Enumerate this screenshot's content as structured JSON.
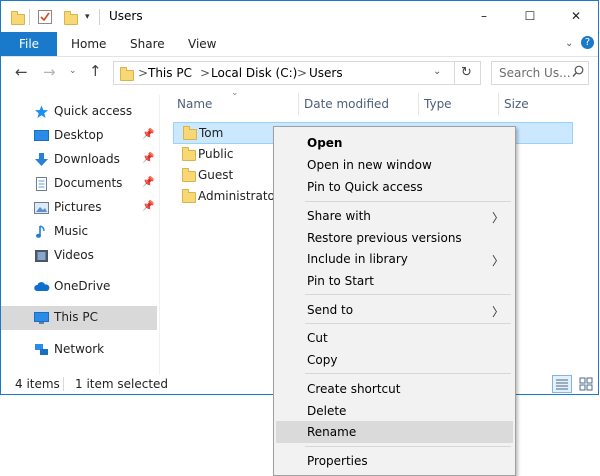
{
  "window": {
    "title": "Users",
    "controls": {
      "minimize": "–",
      "maximize": "☐",
      "close": "✕"
    }
  },
  "ribbon": {
    "file": "File",
    "tabs": [
      "Home",
      "Share",
      "View"
    ]
  },
  "address": {
    "crumbs": [
      "This PC",
      "Local Disk (C:)",
      "Users"
    ],
    "separator": ">",
    "search_placeholder": "Search Us..."
  },
  "sidebar": {
    "items": [
      {
        "label": "Quick access",
        "icon": "star-icon",
        "pinned": false
      },
      {
        "label": "Desktop",
        "icon": "desktop-icon",
        "pinned": true
      },
      {
        "label": "Downloads",
        "icon": "download-icon",
        "pinned": true
      },
      {
        "label": "Documents",
        "icon": "documents-icon",
        "pinned": true
      },
      {
        "label": "Pictures",
        "icon": "pictures-icon",
        "pinned": true
      },
      {
        "label": "Music",
        "icon": "music-icon",
        "pinned": false
      },
      {
        "label": "Videos",
        "icon": "videos-icon",
        "pinned": false
      },
      {
        "label": "OneDrive",
        "icon": "cloud-icon",
        "pinned": false
      },
      {
        "label": "This PC",
        "icon": "computer-icon",
        "pinned": false,
        "selected": true
      },
      {
        "label": "Network",
        "icon": "network-icon",
        "pinned": false
      }
    ]
  },
  "columns": [
    "Name",
    "Date modified",
    "Type",
    "Size"
  ],
  "files": [
    {
      "name": "Tom",
      "selected": true
    },
    {
      "name": "Public"
    },
    {
      "name": "Guest"
    },
    {
      "name": "Administrator"
    }
  ],
  "status": {
    "count": "4 items",
    "selection": "1 item selected"
  },
  "context_menu": {
    "groups": [
      [
        {
          "label": "Open",
          "bold": true
        },
        {
          "label": "Open in new window"
        },
        {
          "label": "Pin to Quick access"
        }
      ],
      [
        {
          "label": "Share with",
          "submenu": true
        },
        {
          "label": "Restore previous versions"
        },
        {
          "label": "Include in library",
          "submenu": true
        },
        {
          "label": "Pin to Start"
        }
      ],
      [
        {
          "label": "Send to",
          "submenu": true
        }
      ],
      [
        {
          "label": "Cut"
        },
        {
          "label": "Copy"
        }
      ],
      [
        {
          "label": "Create shortcut"
        },
        {
          "label": "Delete"
        },
        {
          "label": "Rename",
          "highlighted": true
        }
      ],
      [
        {
          "label": "Properties"
        }
      ]
    ]
  },
  "colors": {
    "accent": "#1979ca",
    "selected_row": "#cce8ff",
    "selected_row_border": "#99d1ff",
    "sidebar_selected": "#d9d9d9",
    "menu_highlight": "#dadada",
    "folder": "#f8d775"
  }
}
